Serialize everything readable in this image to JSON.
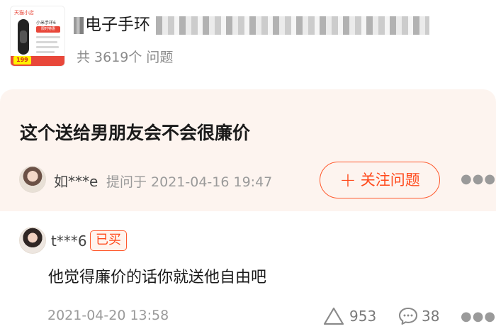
{
  "product": {
    "title_visible": "电子手环",
    "question_count": "共 3619个 问题",
    "thumbnail": {
      "brand": "天猫小店",
      "name": "小米手环6",
      "tag": "限时特惠",
      "price": "199"
    }
  },
  "question": {
    "text": "这个送给男朋友会不会很廉价",
    "asker_name": "如***e",
    "asked_label": "提问于 2021-04-16 19:47",
    "follow_label": "关注问题",
    "more_icon": "more-horizontal-icon"
  },
  "answer": {
    "author_name": "t***6",
    "badge": "已买",
    "text": "他觉得廉价的话你就送他自由吧",
    "date": "2021-04-20 13:58",
    "upvotes": "953",
    "comments": "38",
    "more_icon": "more-horizontal-icon"
  },
  "colors": {
    "accent": "#ff4a1c",
    "card_background": "#fdf4ef",
    "muted_text": "#9a9a9a"
  }
}
